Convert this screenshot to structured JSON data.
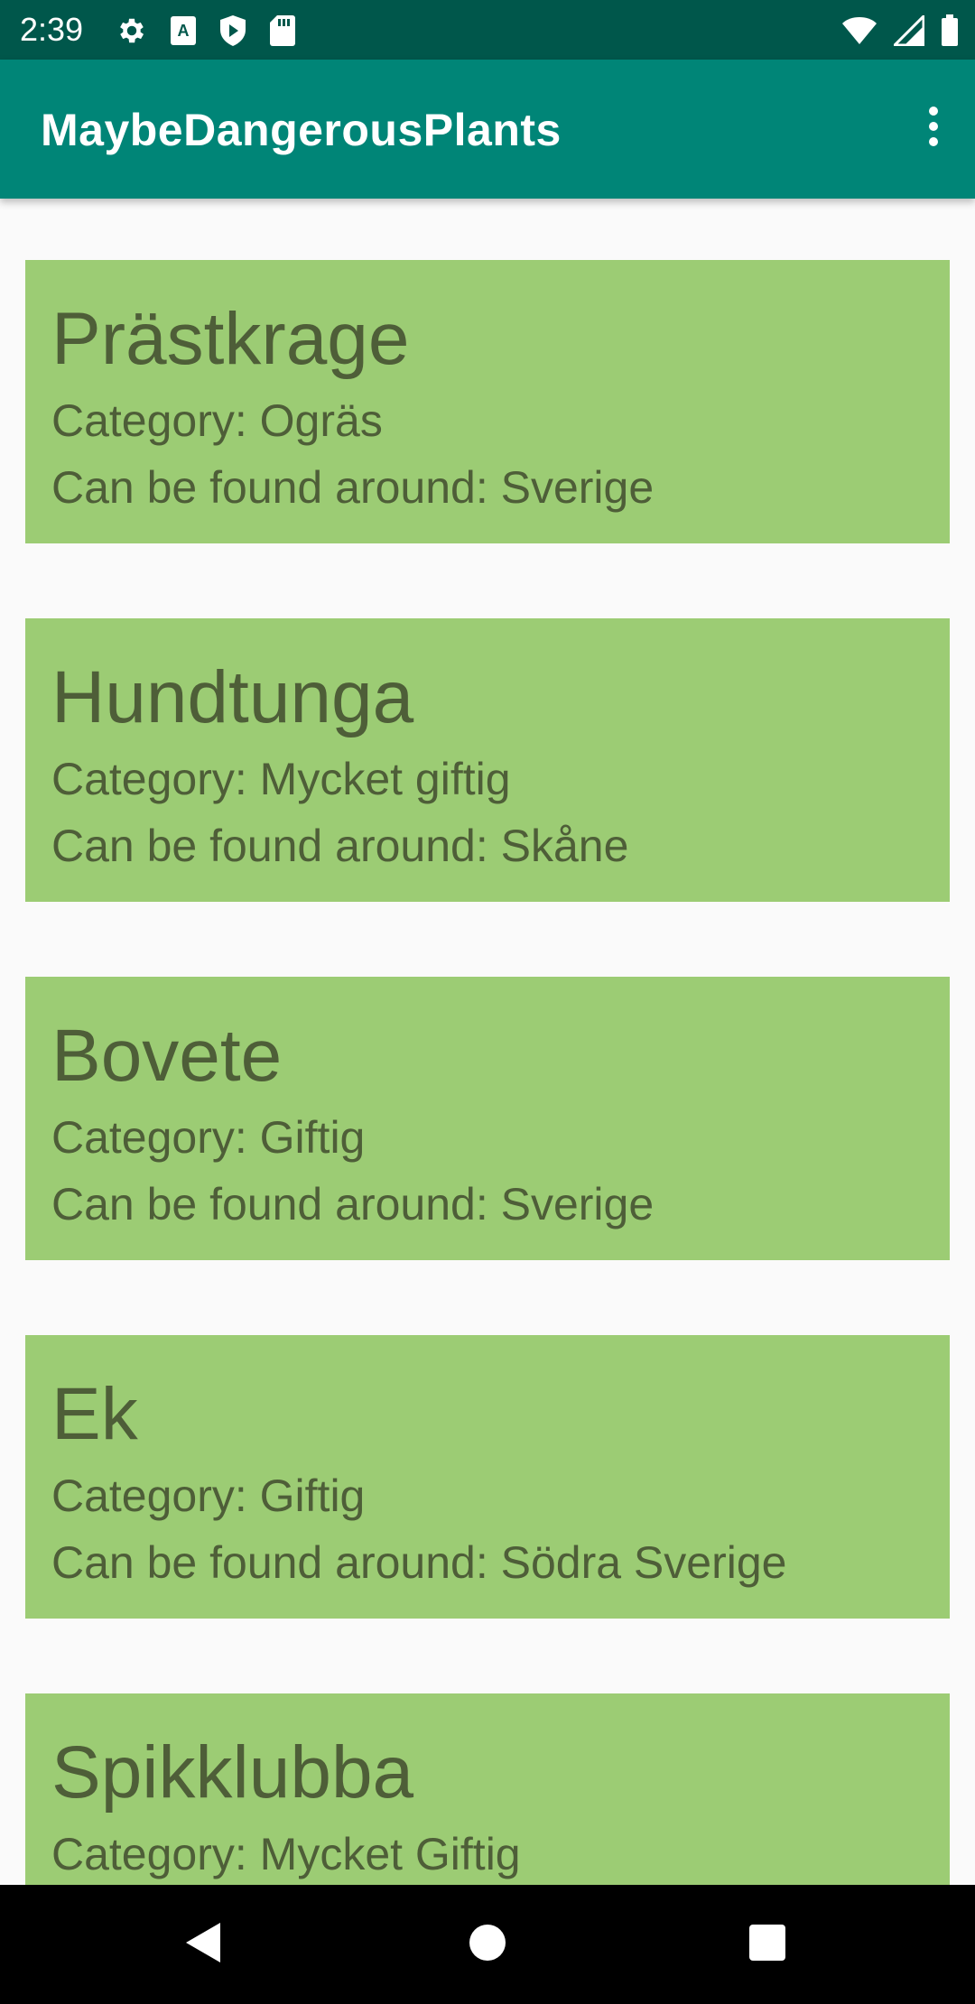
{
  "status_bar": {
    "time": "2:39",
    "left_icons": [
      "gear-icon",
      "font-a-icon",
      "play-shield-icon",
      "sd-card-icon"
    ],
    "right_icons": [
      "wifi-icon",
      "signal-icon",
      "battery-icon"
    ]
  },
  "app_bar": {
    "title": "MaybeDangerousPlants",
    "menu_icon": "more-vert-icon"
  },
  "plants": [
    {
      "name": "Prästkrage",
      "category": "Category: Ogräs",
      "region": "Can be found around: Sverige"
    },
    {
      "name": "Hundtunga",
      "category": "Category: Mycket giftig",
      "region": "Can be found around: Skåne"
    },
    {
      "name": "Bovete",
      "category": "Category: Giftig",
      "region": "Can be found around: Sverige"
    },
    {
      "name": "Ek",
      "category": "Category: Giftig",
      "region": "Can be found around: Södra Sverige"
    },
    {
      "name": "Spikklubba",
      "category": "Category: Mycket Giftig",
      "region": ""
    }
  ],
  "colors": {
    "status_bar": "#00574b",
    "app_bar": "#008577",
    "card_background": "#9ccc74",
    "card_text": "#4e5e38",
    "page_background": "#fafafa"
  },
  "nav_bar": {
    "icons": [
      "back-triangle-icon",
      "home-circle-icon",
      "recents-square-icon"
    ]
  }
}
